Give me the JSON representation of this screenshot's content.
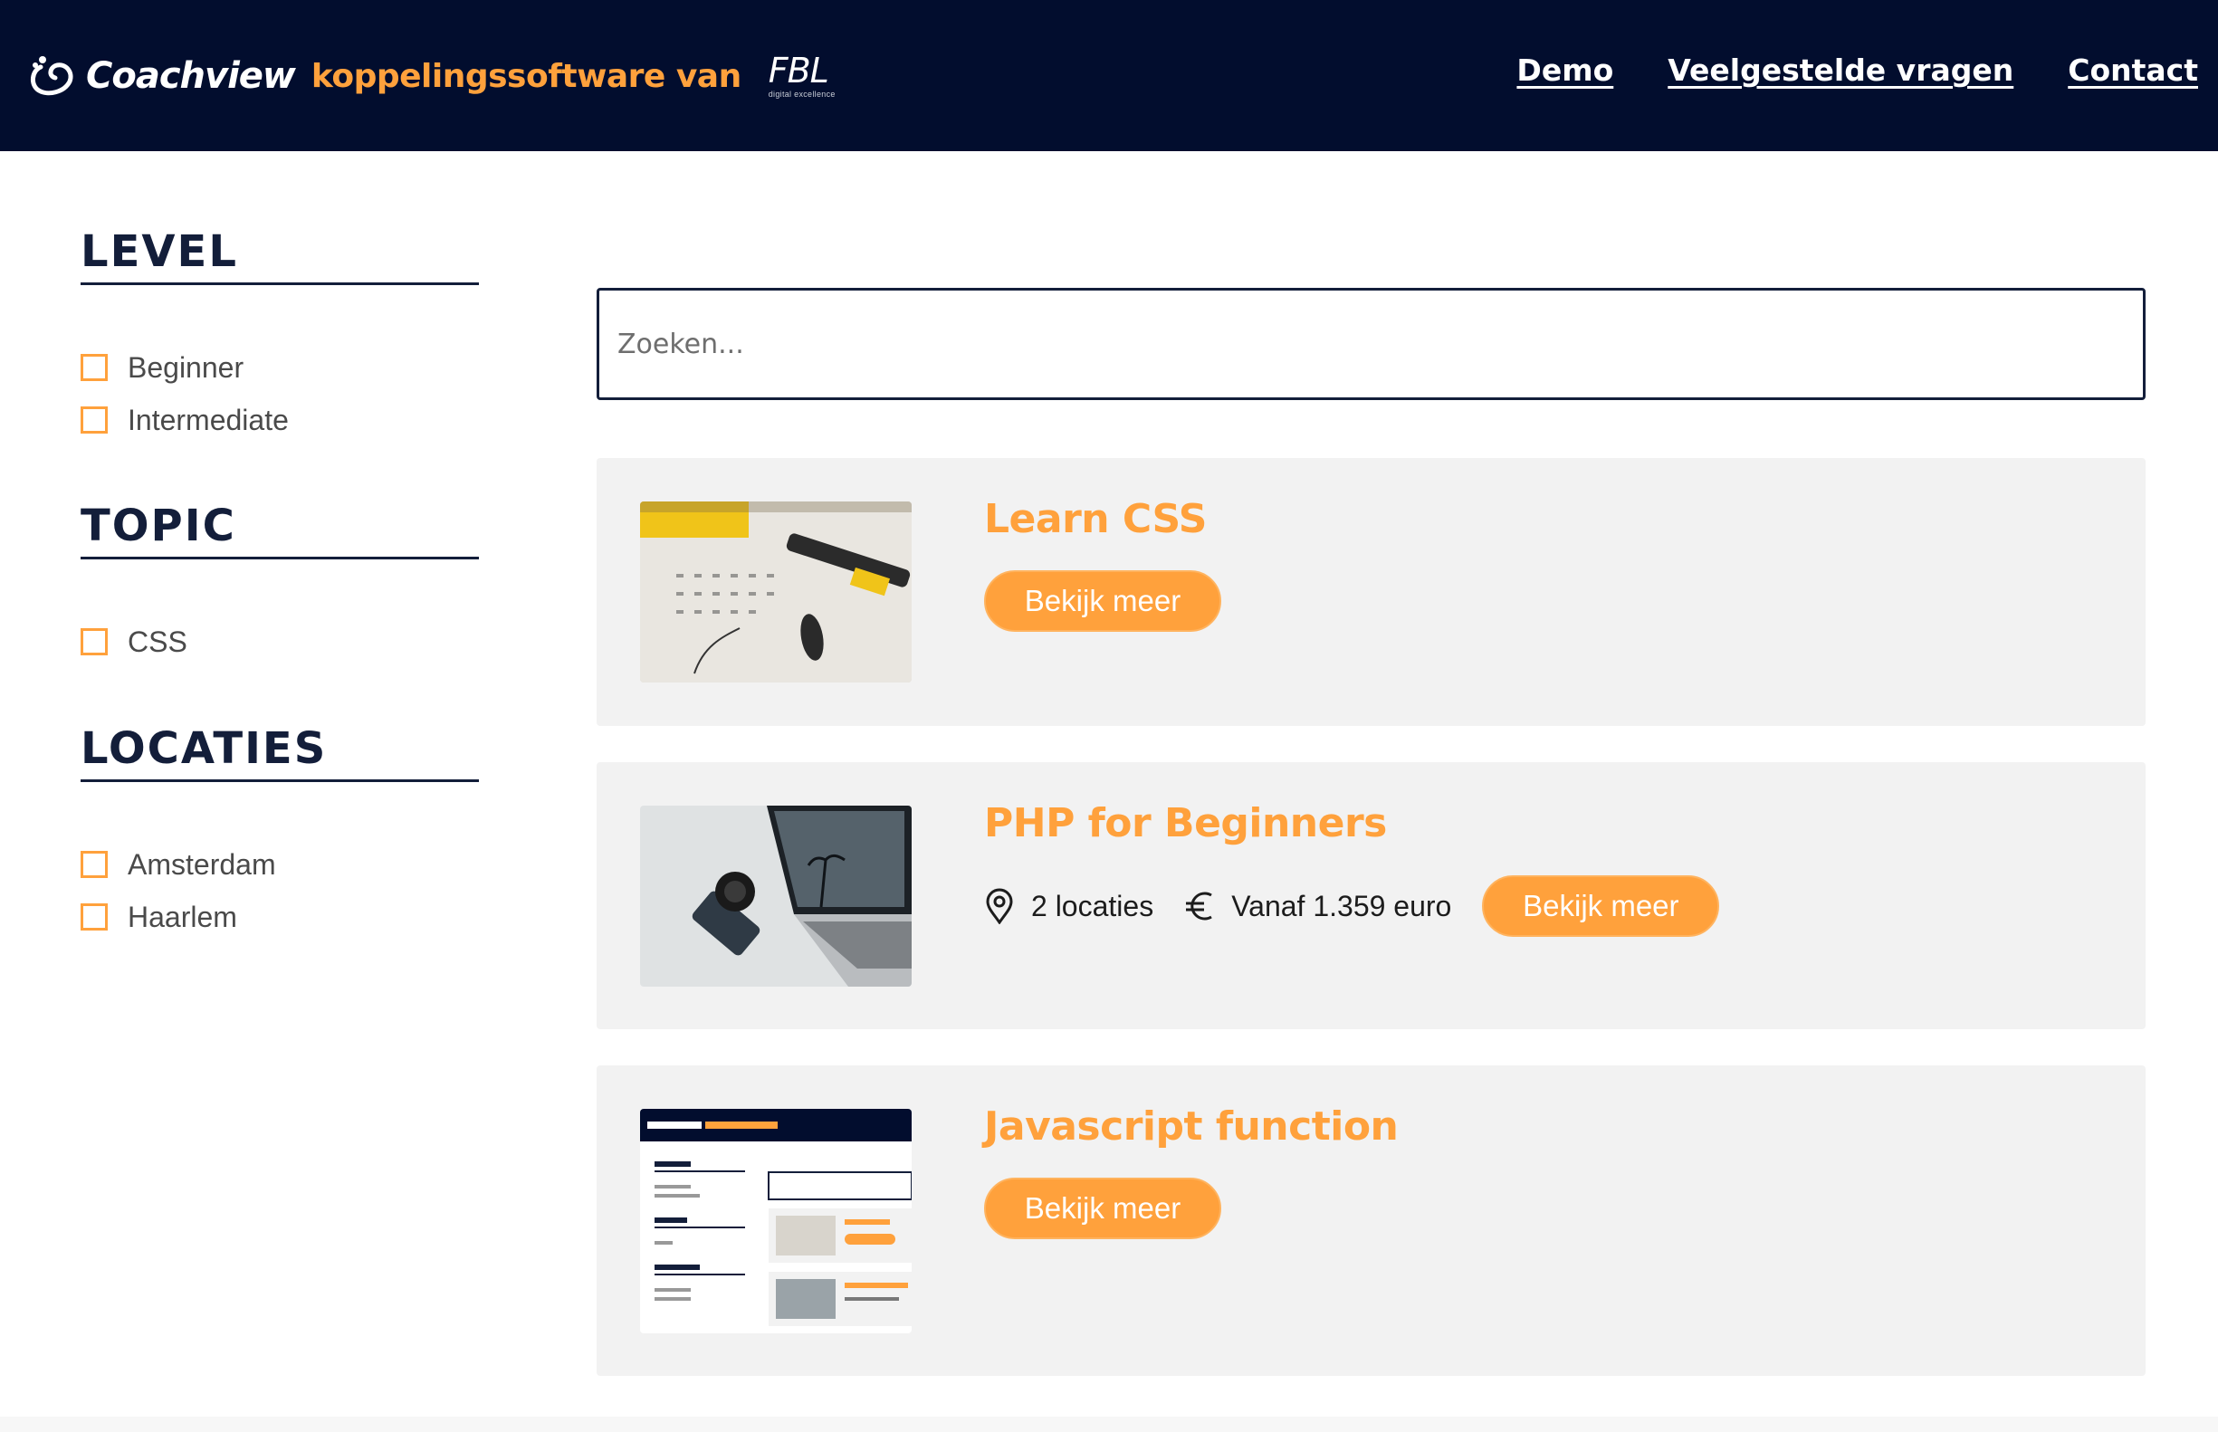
{
  "header": {
    "brand_name": "Coachview",
    "tagline": "koppelingssoftware van",
    "partner_logo": "FBL",
    "partner_sub": "digital excellence",
    "nav": [
      {
        "label": "Demo"
      },
      {
        "label": "Veelgestelde vragen"
      },
      {
        "label": "Contact"
      }
    ]
  },
  "filters": [
    {
      "title": "LEVEL",
      "options": [
        "Beginner",
        "Intermediate"
      ]
    },
    {
      "title": "TOPIC",
      "options": [
        "CSS"
      ]
    },
    {
      "title": "LOCATIES",
      "options": [
        "Amsterdam",
        "Haarlem"
      ]
    }
  ],
  "search": {
    "placeholder": "Zoeken...",
    "value": ""
  },
  "courses": [
    {
      "title": "Learn CSS",
      "button": "Bekijk meer",
      "image": "calendar-notebook-image"
    },
    {
      "title": "PHP for Beginners",
      "locations": "2 locaties",
      "price": "Vanaf 1.359 euro",
      "button": "Bekijk meer",
      "image": "laptop-phone-image",
      "icons": [
        "map-pin-icon",
        "euro-icon"
      ]
    },
    {
      "title": "Javascript function",
      "button": "Bekijk meer",
      "image": "site-screenshot-image"
    }
  ],
  "colors": {
    "navy": "#020d2e",
    "accent": "#ffa13c",
    "card_bg": "#f2f2f2"
  }
}
